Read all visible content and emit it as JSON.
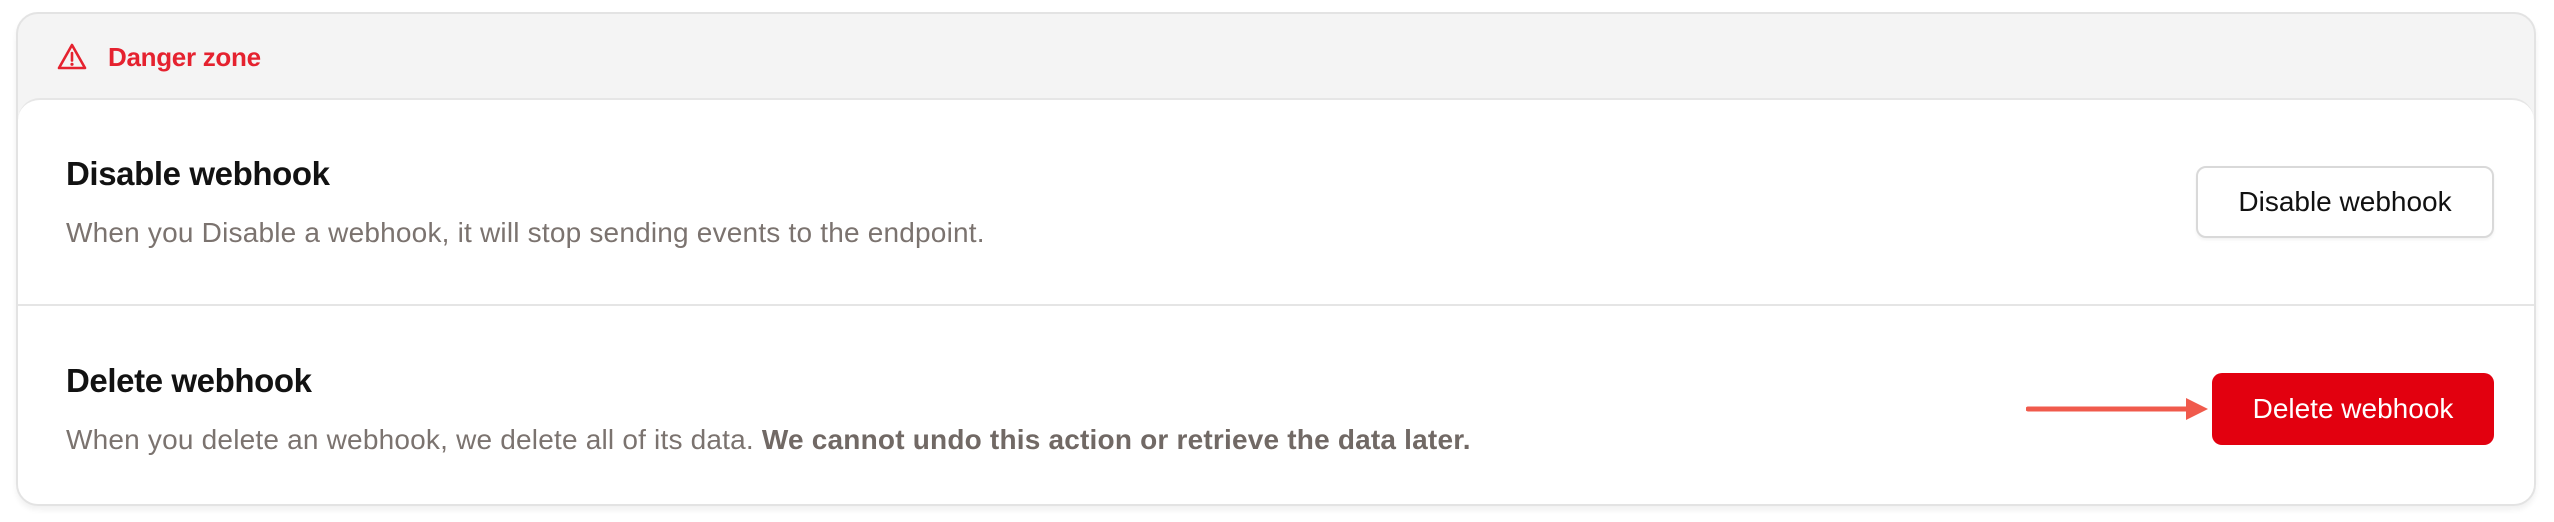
{
  "header": {
    "title": "Danger zone",
    "icon": "warning-triangle-icon",
    "accent_color": "#e5222f"
  },
  "rows": [
    {
      "title": "Disable webhook",
      "description": "When you Disable a webhook, it will stop sending events to the endpoint.",
      "button_label": "Disable webhook"
    },
    {
      "title": "Delete webhook",
      "description": "When you delete an webhook, we delete all of its data. ",
      "description_emphasis": "We cannot undo this action or retrieve the data later.",
      "button_label": "Delete webhook",
      "button_color": "#e2000f"
    }
  ],
  "annotation": {
    "icon": "arrow-right-icon",
    "color": "#f05a4c"
  }
}
